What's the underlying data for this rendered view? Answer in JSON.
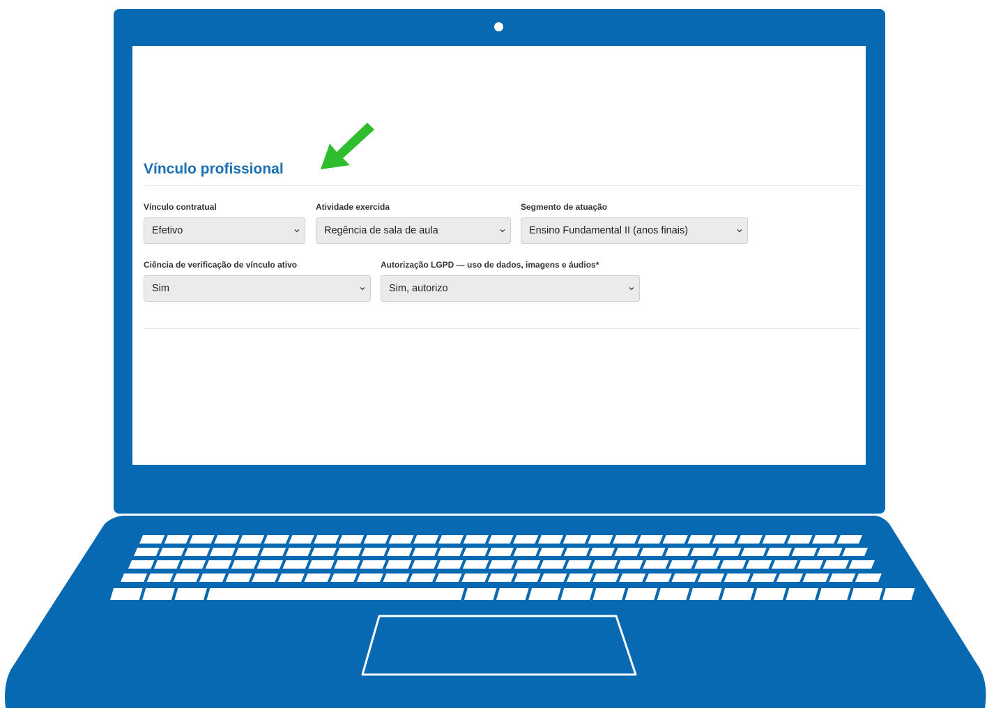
{
  "section": {
    "title": "Vínculo profissional"
  },
  "fields": [
    {
      "label": "Vínculo contratual",
      "value": "Efetivo"
    },
    {
      "label": "Atividade exercida",
      "value": "Regência de sala de aula"
    },
    {
      "label": "Segmento de atuação",
      "value": "Ensino Fundamental II (anos finais)"
    },
    {
      "label": "Ciência de verificação de vínculo ativo",
      "value": "Sim"
    },
    {
      "label": "Autorização LGPD — uso de dados, imagens e áudios*",
      "value": "Sim, autorizo"
    }
  ],
  "colors": {
    "laptop": "#0669b2",
    "title": "#1a6fb4",
    "arrow": "#2dbd2d",
    "select_bg": "#ebebeb"
  },
  "icons": {
    "camera": "camera-dot",
    "pointer": "green-arrow-icon",
    "dropdown": "chevron-down-icon"
  }
}
